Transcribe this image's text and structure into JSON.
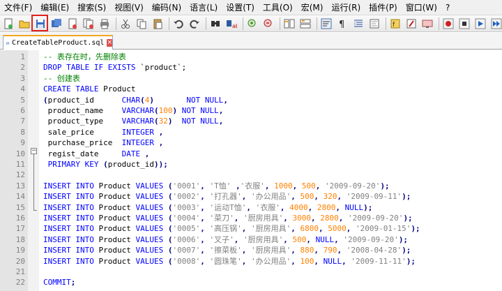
{
  "menu": [
    "文件(F)",
    "编辑(E)",
    "搜索(S)",
    "视图(V)",
    "编码(N)",
    "语言(L)",
    "设置(T)",
    "工具(O)",
    "宏(M)",
    "运行(R)",
    "插件(P)",
    "窗口(W)",
    "?"
  ],
  "toolbar_icons": [
    "new-file-icon",
    "open-file-icon",
    "save-icon",
    "save-all-icon",
    "close-icon",
    "close-all-icon",
    "print-icon",
    "cut-icon",
    "copy-icon",
    "paste-icon",
    "undo-icon",
    "redo-icon",
    "find-icon",
    "replace-icon",
    "zoom-in-icon",
    "zoom-out-icon",
    "sync-vertical-icon",
    "sync-horizontal-icon",
    "word-wrap-icon",
    "show-all-chars-icon",
    "indent-guide-icon",
    "doc-map-icon",
    "function-list-icon",
    "folder-workspace-icon",
    "monitor-icon",
    "record-macro-icon",
    "stop-record-icon",
    "play-macro-icon",
    "run-macro-multiple-icon"
  ],
  "tab": {
    "label": "CreateTableProduct.sql",
    "close": "×"
  },
  "editor": {
    "lines": [
      {
        "n": "1",
        "t": [
          [
            "cm",
            "-- 表存在时，先删除表"
          ]
        ]
      },
      {
        "n": "2",
        "t": [
          [
            "kw",
            "DROP TABLE IF EXISTS "
          ],
          [
            "tx",
            "`product`;"
          ]
        ]
      },
      {
        "n": "3",
        "t": [
          [
            "cm",
            "-- 创建表"
          ]
        ]
      },
      {
        "n": "4",
        "t": [
          [
            "kw",
            "CREATE TABLE "
          ],
          [
            "tx",
            "Product"
          ]
        ]
      },
      {
        "n": "5",
        "t": [
          [
            "op",
            "("
          ],
          [
            "tx",
            "product_id      "
          ],
          [
            "kw",
            "CHAR"
          ],
          [
            "op",
            "("
          ],
          [
            "num",
            "4"
          ],
          [
            "op",
            ")"
          ],
          [
            "tx",
            "       "
          ],
          [
            "kw",
            "NOT NULL"
          ],
          [
            "op",
            ","
          ]
        ]
      },
      {
        "n": "6",
        "t": [
          [
            "tx",
            " product_name    "
          ],
          [
            "kw",
            "VARCHAR"
          ],
          [
            "op",
            "("
          ],
          [
            "num",
            "100"
          ],
          [
            "op",
            ")"
          ],
          [
            "tx",
            " "
          ],
          [
            "kw",
            "NOT NULL"
          ],
          [
            "op",
            ","
          ]
        ]
      },
      {
        "n": "7",
        "t": [
          [
            "tx",
            " product_type    "
          ],
          [
            "kw",
            "VARCHAR"
          ],
          [
            "op",
            "("
          ],
          [
            "num",
            "32"
          ],
          [
            "op",
            ")"
          ],
          [
            "tx",
            "  "
          ],
          [
            "kw",
            "NOT NULL"
          ],
          [
            "op",
            ","
          ]
        ]
      },
      {
        "n": "8",
        "t": [
          [
            "tx",
            " sale_price      "
          ],
          [
            "kw",
            "INTEGER"
          ],
          [
            "tx",
            " "
          ],
          [
            "op",
            ","
          ]
        ]
      },
      {
        "n": "9",
        "t": [
          [
            "tx",
            " purchase_price  "
          ],
          [
            "kw",
            "INTEGER"
          ],
          [
            "tx",
            " "
          ],
          [
            "op",
            ","
          ]
        ]
      },
      {
        "n": "10",
        "t": [
          [
            "tx",
            " regist_date     "
          ],
          [
            "kw",
            "DATE"
          ],
          [
            "tx",
            " "
          ],
          [
            "op",
            ","
          ]
        ]
      },
      {
        "n": "11",
        "t": [
          [
            "tx",
            " "
          ],
          [
            "kw",
            "PRIMARY KEY "
          ],
          [
            "op",
            "("
          ],
          [
            "tx",
            "product_id"
          ],
          [
            "op",
            "));"
          ]
        ]
      },
      {
        "n": "12",
        "t": []
      },
      {
        "n": "13",
        "t": [
          [
            "kw",
            "INSERT INTO "
          ],
          [
            "tx",
            "Product "
          ],
          [
            "kw",
            "VALUES "
          ],
          [
            "op",
            "("
          ],
          [
            "str",
            "'0001'"
          ],
          [
            "op",
            ", "
          ],
          [
            "str",
            "'T恤'"
          ],
          [
            "op",
            " ,"
          ],
          [
            "str",
            "'衣服'"
          ],
          [
            "op",
            ", "
          ],
          [
            "num",
            "1000"
          ],
          [
            "op",
            ", "
          ],
          [
            "num",
            "500"
          ],
          [
            "op",
            ", "
          ],
          [
            "str",
            "'2009-09-20'"
          ],
          [
            "op",
            ");"
          ]
        ]
      },
      {
        "n": "14",
        "t": [
          [
            "kw",
            "INSERT INTO "
          ],
          [
            "tx",
            "Product "
          ],
          [
            "kw",
            "VALUES "
          ],
          [
            "op",
            "("
          ],
          [
            "str",
            "'0002'"
          ],
          [
            "op",
            ", "
          ],
          [
            "str",
            "'打孔器'"
          ],
          [
            "op",
            ", "
          ],
          [
            "str",
            "'办公用品'"
          ],
          [
            "op",
            ", "
          ],
          [
            "num",
            "500"
          ],
          [
            "op",
            ", "
          ],
          [
            "num",
            "320"
          ],
          [
            "op",
            ", "
          ],
          [
            "str",
            "'2009-09-11'"
          ],
          [
            "op",
            ");"
          ]
        ]
      },
      {
        "n": "15",
        "t": [
          [
            "kw",
            "INSERT INTO "
          ],
          [
            "tx",
            "Product "
          ],
          [
            "kw",
            "VALUES "
          ],
          [
            "op",
            "("
          ],
          [
            "str",
            "'0003'"
          ],
          [
            "op",
            ", "
          ],
          [
            "str",
            "'运动T恤'"
          ],
          [
            "op",
            ", "
          ],
          [
            "str",
            "'衣服'"
          ],
          [
            "op",
            ", "
          ],
          [
            "num",
            "4000"
          ],
          [
            "op",
            ", "
          ],
          [
            "num",
            "2800"
          ],
          [
            "op",
            ", "
          ],
          [
            "kw",
            "NULL"
          ],
          [
            "op",
            ");"
          ]
        ]
      },
      {
        "n": "16",
        "t": [
          [
            "kw",
            "INSERT INTO "
          ],
          [
            "tx",
            "Product "
          ],
          [
            "kw",
            "VALUES "
          ],
          [
            "op",
            "("
          ],
          [
            "str",
            "'0004'"
          ],
          [
            "op",
            ", "
          ],
          [
            "str",
            "'菜刀'"
          ],
          [
            "op",
            ", "
          ],
          [
            "str",
            "'厨房用具'"
          ],
          [
            "op",
            ", "
          ],
          [
            "num",
            "3000"
          ],
          [
            "op",
            ", "
          ],
          [
            "num",
            "2800"
          ],
          [
            "op",
            ", "
          ],
          [
            "str",
            "'2009-09-20'"
          ],
          [
            "op",
            ");"
          ]
        ]
      },
      {
        "n": "17",
        "t": [
          [
            "kw",
            "INSERT INTO "
          ],
          [
            "tx",
            "Product "
          ],
          [
            "kw",
            "VALUES "
          ],
          [
            "op",
            "("
          ],
          [
            "str",
            "'0005'"
          ],
          [
            "op",
            ", "
          ],
          [
            "str",
            "'高压锅'"
          ],
          [
            "op",
            ", "
          ],
          [
            "str",
            "'厨房用具'"
          ],
          [
            "op",
            ", "
          ],
          [
            "num",
            "6800"
          ],
          [
            "op",
            ", "
          ],
          [
            "num",
            "5000"
          ],
          [
            "op",
            ", "
          ],
          [
            "str",
            "'2009-01-15'"
          ],
          [
            "op",
            ");"
          ]
        ]
      },
      {
        "n": "18",
        "t": [
          [
            "kw",
            "INSERT INTO "
          ],
          [
            "tx",
            "Product "
          ],
          [
            "kw",
            "VALUES "
          ],
          [
            "op",
            "("
          ],
          [
            "str",
            "'0006'"
          ],
          [
            "op",
            ", "
          ],
          [
            "str",
            "'叉子'"
          ],
          [
            "op",
            ", "
          ],
          [
            "str",
            "'厨房用具'"
          ],
          [
            "op",
            ", "
          ],
          [
            "num",
            "500"
          ],
          [
            "op",
            ", "
          ],
          [
            "kw",
            "NULL"
          ],
          [
            "op",
            ", "
          ],
          [
            "str",
            "'2009-09-20'"
          ],
          [
            "op",
            ");"
          ]
        ]
      },
      {
        "n": "19",
        "t": [
          [
            "kw",
            "INSERT INTO "
          ],
          [
            "tx",
            "Product "
          ],
          [
            "kw",
            "VALUES "
          ],
          [
            "op",
            "("
          ],
          [
            "str",
            "'0007'"
          ],
          [
            "op",
            ", "
          ],
          [
            "str",
            "'擦菜板'"
          ],
          [
            "op",
            ", "
          ],
          [
            "str",
            "'厨房用具'"
          ],
          [
            "op",
            ", "
          ],
          [
            "num",
            "880"
          ],
          [
            "op",
            ", "
          ],
          [
            "num",
            "790"
          ],
          [
            "op",
            ", "
          ],
          [
            "str",
            "'2008-04-28'"
          ],
          [
            "op",
            ");"
          ]
        ]
      },
      {
        "n": "20",
        "t": [
          [
            "kw",
            "INSERT INTO "
          ],
          [
            "tx",
            "Product "
          ],
          [
            "kw",
            "VALUES "
          ],
          [
            "op",
            "("
          ],
          [
            "str",
            "'0008'"
          ],
          [
            "op",
            ", "
          ],
          [
            "str",
            "'圆珠笔'"
          ],
          [
            "op",
            ", "
          ],
          [
            "str",
            "'办公用品'"
          ],
          [
            "op",
            ", "
          ],
          [
            "num",
            "100"
          ],
          [
            "op",
            ", "
          ],
          [
            "kw",
            "NULL"
          ],
          [
            "op",
            ", "
          ],
          [
            "str",
            "'2009-11-11'"
          ],
          [
            "op",
            ");"
          ]
        ]
      },
      {
        "n": "21",
        "t": []
      },
      {
        "n": "22",
        "t": [
          [
            "kw",
            "COMMIT"
          ],
          [
            "op",
            ";"
          ]
        ]
      }
    ]
  },
  "colors": {
    "keyword": "#0000ff",
    "comment": "#008000",
    "number": "#ff8000",
    "string": "#808080",
    "operator": "#000080",
    "highlight": "#e02020"
  }
}
